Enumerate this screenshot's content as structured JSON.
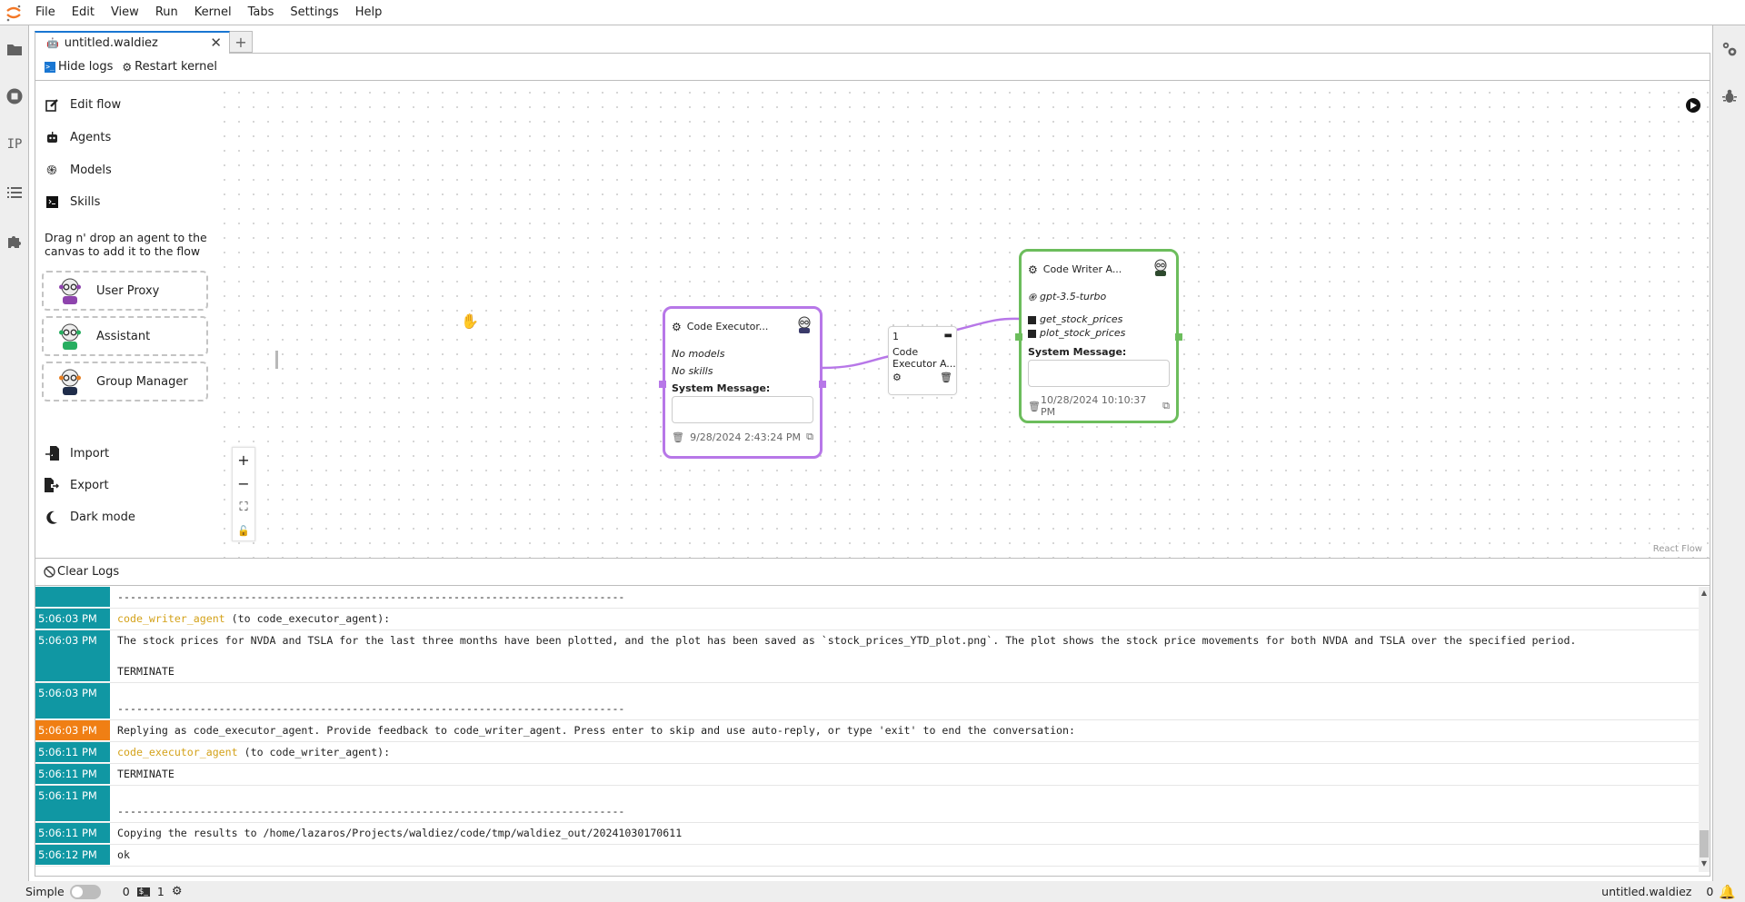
{
  "menubar": {
    "items": [
      "File",
      "Edit",
      "View",
      "Run",
      "Kernel",
      "Tabs",
      "Settings",
      "Help"
    ]
  },
  "left_bar": {
    "icons": [
      "folder-icon",
      "running-icon",
      "property-inspector-icon",
      "table-of-contents-icon",
      "extension-icon"
    ],
    "property_label": "IP"
  },
  "right_bar": {
    "icons": [
      "property-settings-icon",
      "debugger-icon"
    ]
  },
  "tabs": [
    {
      "label": "untitled.waldiez",
      "active": true
    }
  ],
  "toolbar": {
    "hide_logs": "Hide logs",
    "restart_kernel": "Restart kernel"
  },
  "sidebar": {
    "items": [
      {
        "label": "Edit flow",
        "icon": "edit-icon"
      },
      {
        "label": "Agents",
        "icon": "robot-icon"
      },
      {
        "label": "Models",
        "icon": "openai-icon"
      },
      {
        "label": "Skills",
        "icon": "terminal-icon"
      }
    ],
    "hint": "Drag n' drop an agent to the canvas to add it to the flow",
    "agents": [
      {
        "label": "User Proxy",
        "color": "#8e44ad"
      },
      {
        "label": "Assistant",
        "color": "#27ae60"
      },
      {
        "label": "Group Manager",
        "color": "#e67e22"
      }
    ],
    "bottom_items": [
      {
        "label": "Import",
        "icon": "import-icon"
      },
      {
        "label": "Export",
        "icon": "export-icon"
      },
      {
        "label": "Dark mode",
        "icon": "moon-icon"
      }
    ]
  },
  "flow": {
    "controls": [
      "+",
      "−",
      "fit",
      "lock"
    ],
    "attribution": "React Flow",
    "nodes": [
      {
        "id": "executor",
        "title": "Code Executor...",
        "models_text": "No models",
        "skills_text": "No skills",
        "system_label": "System Message:",
        "system_value": "",
        "date": "9/28/2024 2:43:24 PM",
        "color": "#b777e8"
      },
      {
        "id": "writer",
        "title": "Code Writer A...",
        "model": "gpt-3.5-turbo",
        "skills": [
          "get_stock_prices",
          "plot_stock_prices"
        ],
        "system_label": "System Message:",
        "system_value": "",
        "date": "10/28/2024 10:10:37 PM",
        "color": "#6cbd5c"
      }
    ],
    "edge": {
      "order": "1",
      "label": "Code Executor A...",
      "color": "#b777e8"
    }
  },
  "logs": {
    "clear_label": "Clear Logs",
    "entries": [
      {
        "time": "",
        "parts": [
          {
            "text": "--------------------------------------------------------------------------------"
          }
        ],
        "level": "info"
      },
      {
        "time": "5:06:03 PM",
        "parts": [
          {
            "text": "code_writer_agent",
            "agent": true
          },
          {
            "text": " (to code_executor_agent):\n"
          }
        ],
        "level": "info"
      },
      {
        "time": "5:06:03 PM",
        "parts": [
          {
            "text": "The stock prices for NVDA and TSLA for the last three months have been plotted, and the plot has been saved as `stock_prices_YTD_plot.png`. The plot shows the stock price movements for both NVDA and TSLA over the specified period.\n\nTERMINATE"
          }
        ],
        "level": "info"
      },
      {
        "time": "5:06:03 PM",
        "parts": [
          {
            "text": "\n--------------------------------------------------------------------------------"
          }
        ],
        "level": "info"
      },
      {
        "time": "5:06:03 PM",
        "parts": [
          {
            "text": "Replying as code_executor_agent. Provide feedback to code_writer_agent. Press enter to skip and use auto-reply, or type 'exit' to end the conversation:"
          }
        ],
        "level": "warn"
      },
      {
        "time": "5:06:11 PM",
        "parts": [
          {
            "text": "code_executor_agent",
            "agent": true
          },
          {
            "text": " (to code_writer_agent):\n"
          }
        ],
        "level": "info"
      },
      {
        "time": "5:06:11 PM",
        "parts": [
          {
            "text": "TERMINATE"
          }
        ],
        "level": "info"
      },
      {
        "time": "5:06:11 PM",
        "parts": [
          {
            "text": "\n--------------------------------------------------------------------------------"
          }
        ],
        "level": "info"
      },
      {
        "time": "5:06:11 PM",
        "parts": [
          {
            "text": "Copying the results to /home/lazaros/Projects/waldiez/code/tmp/waldiez_out/20241030170611"
          }
        ],
        "level": "info"
      },
      {
        "time": "5:06:12 PM",
        "parts": [
          {
            "text": "ok"
          }
        ],
        "level": "info"
      }
    ]
  },
  "statusbar": {
    "mode_label": "Simple",
    "simple_mode_on": false,
    "terminals": "0",
    "kernels": "1",
    "document": "untitled.waldiez",
    "notifications": "0"
  },
  "colors": {
    "accent": "#1976d2",
    "log_time": "#1097a3",
    "log_warn": "#f07f14",
    "agent_name": "#d4a21a"
  }
}
